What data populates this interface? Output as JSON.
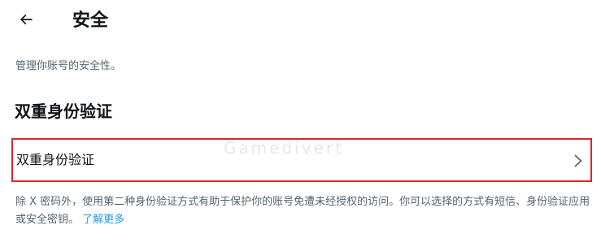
{
  "header": {
    "back_icon": "arrow-left-icon",
    "title": "安全"
  },
  "subtitle": "管理你账号的安全性。",
  "section": {
    "title": "双重身份验证",
    "row_label": "双重身份验证",
    "row_icon": "chevron-right-icon",
    "highlight_color": "#d9262f"
  },
  "description": {
    "text": "除 X 密码外，使用第二种身份验证方式有助于保护你的账号免遭未经授权的访问。你可以选择的方式有短信、身份验证应用或安全密钥。",
    "link_label": "了解更多",
    "link_color": "#1d9bf0"
  },
  "watermark": {
    "text": "Gamedivert"
  }
}
